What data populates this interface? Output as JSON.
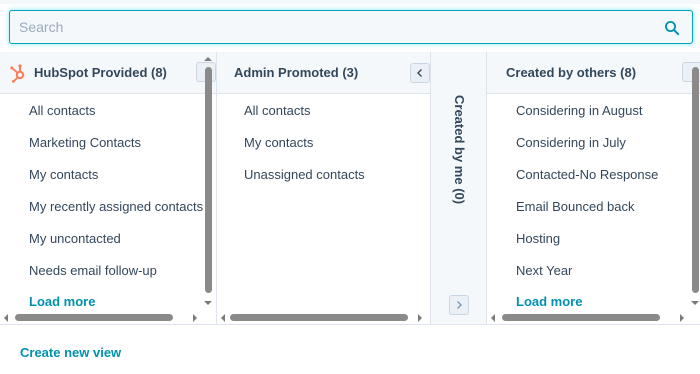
{
  "search": {
    "placeholder": "Search",
    "value": ""
  },
  "columns": [
    {
      "title": "HubSpot Provided (8)",
      "items": [
        "All contacts",
        "Marketing Contacts",
        "My contacts",
        "My recently assigned contacts",
        "My uncontacted",
        "Needs email follow-up"
      ],
      "load_more": "Load more"
    },
    {
      "title": "Admin Promoted (3)",
      "items": [
        "All contacts",
        "My contacts",
        "Unassigned contacts"
      ]
    },
    {
      "title": "Created by me (0)",
      "collapsed": true
    },
    {
      "title": "Created by others (8)",
      "items": [
        "Considering in August",
        "Considering in July",
        "Contacted-No Response",
        "Email Bounced back",
        "Hosting",
        "Next Year"
      ],
      "load_more": "Load more"
    }
  ],
  "footer": {
    "create_new_view": "Create new view"
  },
  "colors": {
    "accent": "#0091ae",
    "focus": "#00a4bd",
    "text": "#33475b",
    "hubspot_orange": "#ff7a59"
  },
  "icons": [
    "search-icon",
    "hubspot-sprocket-icon",
    "chevron-left-icon",
    "chevron-right-icon"
  ]
}
